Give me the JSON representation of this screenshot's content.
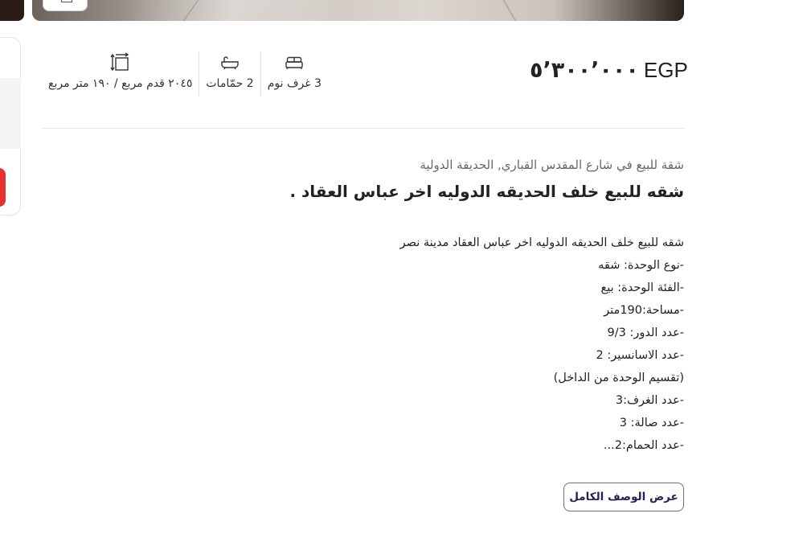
{
  "listing": {
    "price": {
      "amount": "٥٬٣٠٠٬٠٠٠",
      "currency": "EGP"
    },
    "specs": [
      {
        "icon": "bed-icon",
        "label": "3 غرف نوم"
      },
      {
        "icon": "bathtub-icon",
        "label": "2 حمّامات"
      },
      {
        "icon": "area-icon",
        "label": "٢٠٤٥ قدم مربع / ١٩٠ متر مربع"
      }
    ],
    "location": "شقة للبيع في شارع المقدس القباري, الحديقة الدولية",
    "title": "شقه للبيع خلف الحديقه الدوليه اخر عباس العقاد .",
    "description_lines": [
      "شقه للبيع خلف الحديقه الدوليه اخر عباس العقاد مدينة نصر",
      "-نوع الوحدة: شقه",
      "-الفئة الوحدة: بيع",
      "-مساحة:190متر",
      "-عدد الدور: 9/3",
      "-عدد الاسانسير: 2",
      "(تقسيم الوحدة من الداخل)",
      "-عدد الغرف:3",
      "-عدد صالة: 3",
      "-عدد الحمام:2..."
    ],
    "show_full_description_label": "عرض الوصف الكامل"
  },
  "colors": {
    "accent": "#23235a",
    "cta_red": "#e8312d",
    "divider": "#e6e6e6"
  }
}
